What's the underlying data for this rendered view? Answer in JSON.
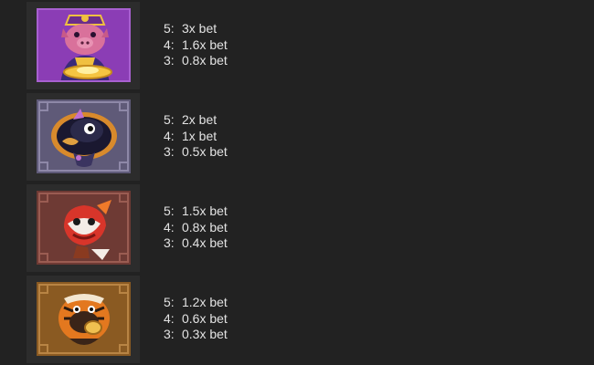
{
  "symbols": [
    {
      "icon": "pig-general-icon",
      "accent": "#8e3fb8",
      "payouts": [
        {
          "count": "5:",
          "value": "3x bet"
        },
        {
          "count": "4:",
          "value": "1.6x bet"
        },
        {
          "count": "3:",
          "value": "0.8x bet"
        }
      ]
    },
    {
      "icon": "black-lion-icon",
      "accent": "#6a6488",
      "payouts": [
        {
          "count": "5:",
          "value": "2x bet"
        },
        {
          "count": "4:",
          "value": "1x bet"
        },
        {
          "count": "3:",
          "value": "0.5x bet"
        }
      ]
    },
    {
      "icon": "red-lion-icon",
      "accent": "#7a4038",
      "payouts": [
        {
          "count": "5:",
          "value": "1.5x bet"
        },
        {
          "count": "4:",
          "value": "0.8x bet"
        },
        {
          "count": "3:",
          "value": "0.4x bet"
        }
      ]
    },
    {
      "icon": "tiger-lion-icon",
      "accent": "#8a5a22",
      "payouts": [
        {
          "count": "5:",
          "value": "1.2x bet"
        },
        {
          "count": "4:",
          "value": "0.6x bet"
        },
        {
          "count": "3:",
          "value": "0.3x bet"
        }
      ]
    }
  ]
}
